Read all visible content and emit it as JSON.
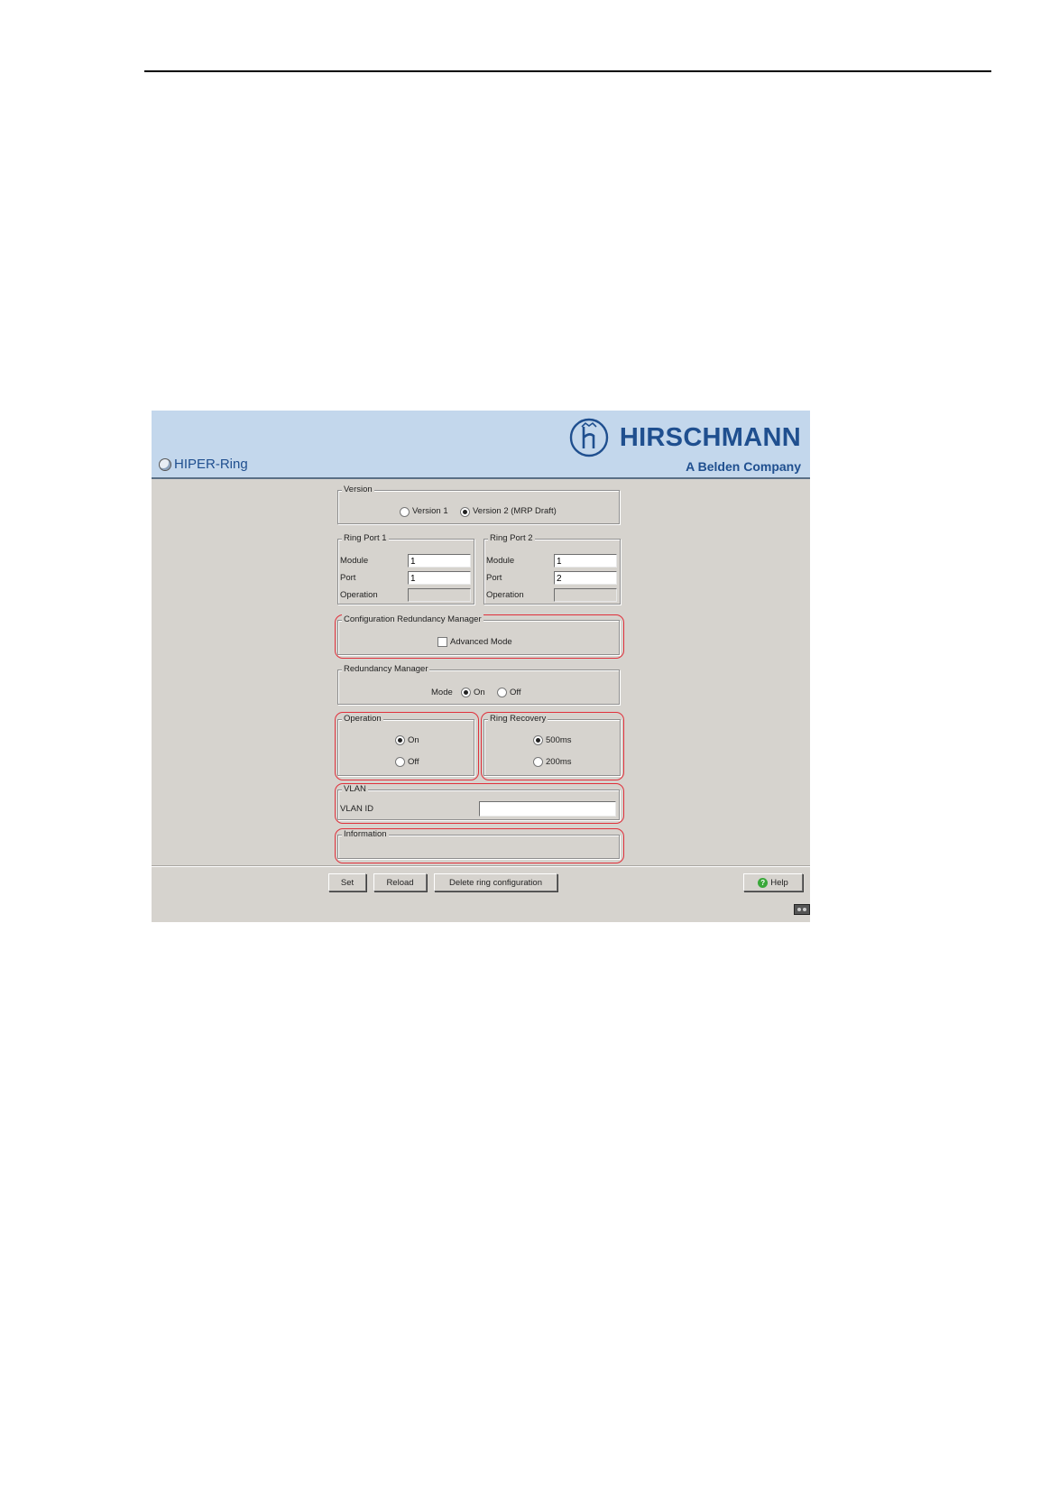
{
  "window": {
    "title": "HIPER-Ring",
    "brand_name": "HIRSCHMANN",
    "brand_tagline": "A Belden Company"
  },
  "version": {
    "legend": "Version",
    "options": [
      "Version 1",
      "Version 2 (MRP Draft)"
    ],
    "selected": "Version 2 (MRP Draft)"
  },
  "ring_port_1": {
    "legend": "Ring Port 1",
    "module_label": "Module",
    "module_value": "1",
    "port_label": "Port",
    "port_value": "1",
    "operation_label": "Operation",
    "operation_value": ""
  },
  "ring_port_2": {
    "legend": "Ring Port 2",
    "module_label": "Module",
    "module_value": "1",
    "port_label": "Port",
    "port_value": "2",
    "operation_label": "Operation",
    "operation_value": ""
  },
  "config_redundancy_manager": {
    "legend": "Configuration Redundancy Manager",
    "advanced_mode_label": "Advanced Mode",
    "advanced_mode_checked": false
  },
  "redundancy_manager": {
    "legend": "Redundancy Manager",
    "mode_label": "Mode",
    "options": [
      "On",
      "Off"
    ],
    "selected": "On"
  },
  "operation": {
    "legend": "Operation",
    "options": [
      "On",
      "Off"
    ],
    "selected": "On"
  },
  "ring_recovery": {
    "legend": "Ring Recovery",
    "options": [
      "500ms",
      "200ms"
    ],
    "selected": "500ms"
  },
  "vlan": {
    "legend": "VLAN",
    "vlan_id_label": "VLAN ID",
    "vlan_id_value": ""
  },
  "information": {
    "legend": "Information"
  },
  "buttons": {
    "set": "Set",
    "reload": "Reload",
    "delete": "Delete ring configuration",
    "help": "Help"
  },
  "colors": {
    "header_bg": "#c3d7ec",
    "panel_bg": "#d6d3ce",
    "brand": "#1f4f8f",
    "highlight": "#e0303b"
  }
}
